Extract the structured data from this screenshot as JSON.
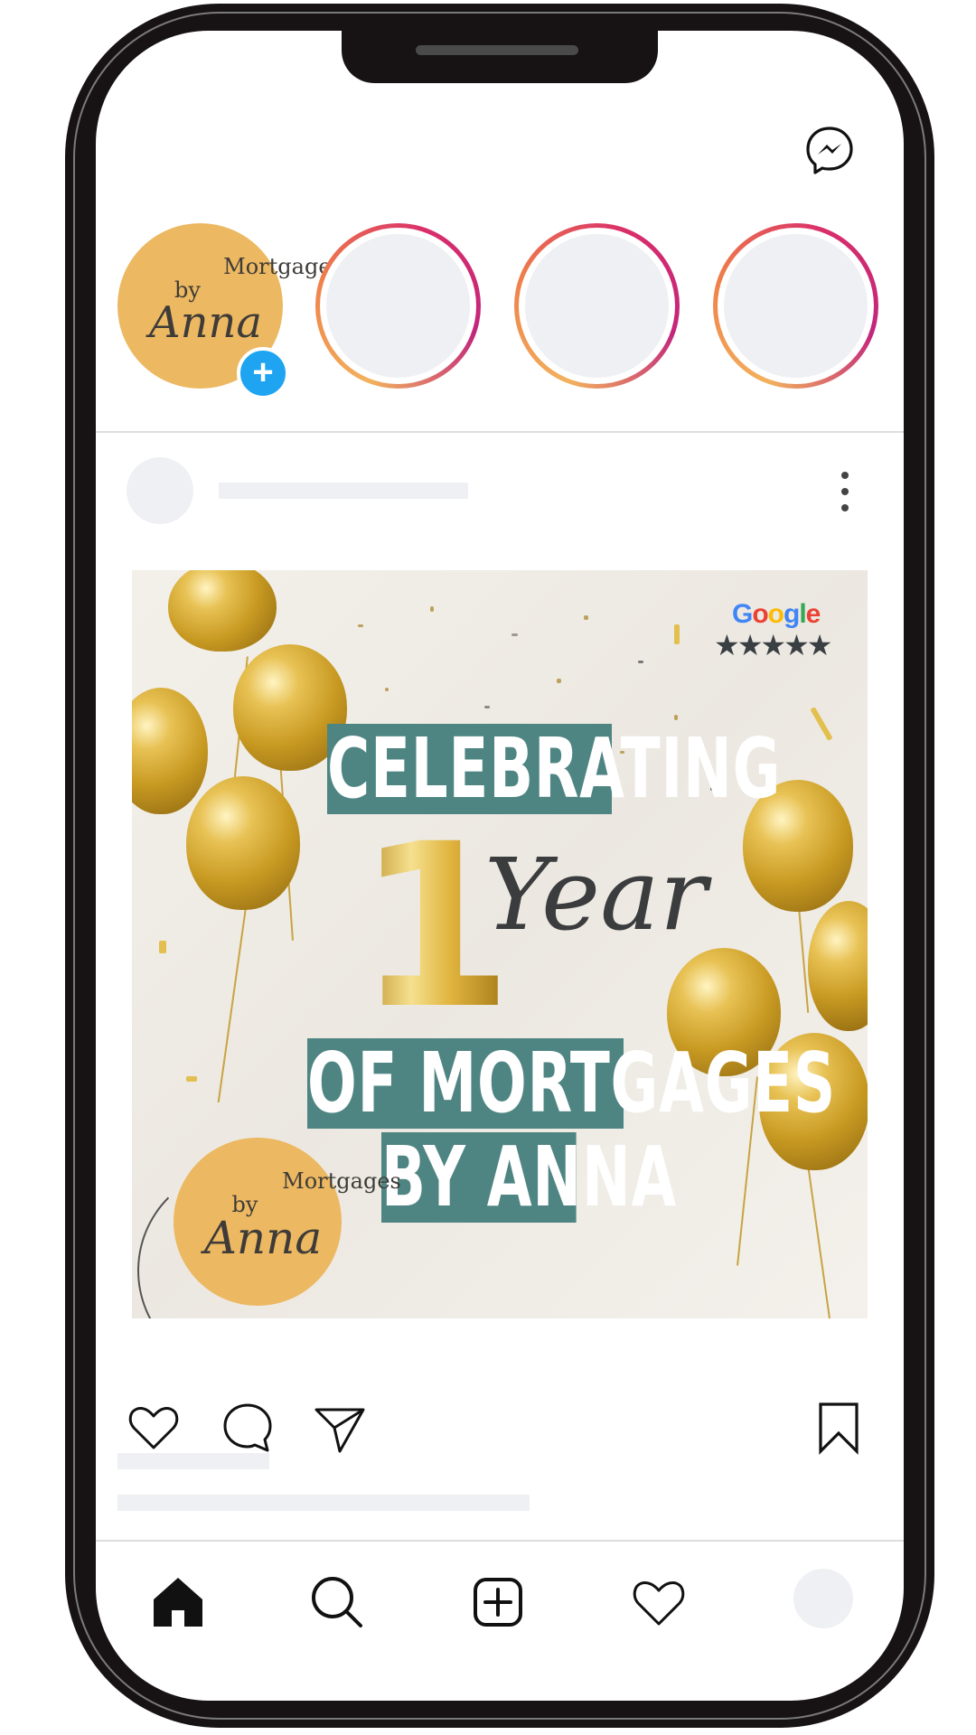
{
  "stories": {
    "own": {
      "line1": "Mortgages",
      "line2": "by",
      "line3": "Anna",
      "add_icon": "plus-icon",
      "color": "#ecb861"
    },
    "others_count": 3
  },
  "header": {
    "messenger_icon": "messenger-icon"
  },
  "post": {
    "image": {
      "google_text": "Google",
      "stars": "★★★★★",
      "headline_top": "CELEBRATING",
      "big_number": "1",
      "script_word": "Year",
      "headline_bottom_1": "OF MORTGAGES",
      "headline_bottom_2": "BY ANNA",
      "badge_line1": "Mortgages",
      "badge_line2": "by",
      "badge_line3": "Anna",
      "accent_teal": "#4e8582",
      "accent_gold": "#ecb861"
    },
    "actions": [
      "like-icon",
      "comment-icon",
      "share-icon",
      "bookmark-icon"
    ]
  },
  "nav": {
    "items": [
      "home-icon",
      "search-icon",
      "new-post-icon",
      "activity-icon",
      "profile-avatar"
    ]
  }
}
